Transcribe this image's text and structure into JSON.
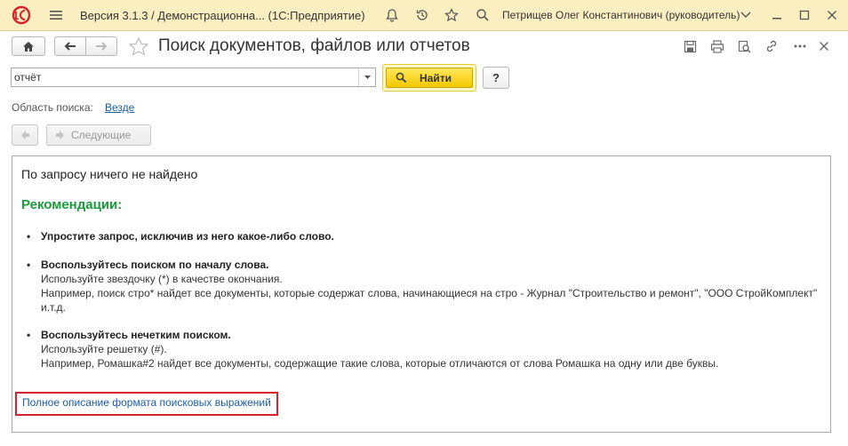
{
  "titlebar": {
    "title": "Версия 3.1.3 / Демонстрационна...  (1С:Предприятие)",
    "user": "Петрищев Олег Константинович (руководитель)"
  },
  "header": {
    "page_title": "Поиск документов, файлов или отчетов"
  },
  "search": {
    "value": "отчёт",
    "find_label": "Найти",
    "help_label": "?"
  },
  "search_area": {
    "label": "Область поиска:",
    "value": "Везде"
  },
  "paging": {
    "next_label": "Следующие"
  },
  "results": {
    "nothing_found": "По запросу ничего не найдено",
    "recommendations_title": "Рекомендации:",
    "tips": [
      {
        "head": "Упростите запрос, исключив из него какое-либо слово.",
        "lines": []
      },
      {
        "head": "Воспользуйтесь поиском по началу слова.",
        "lines": [
          "Используйте звездочку (*) в качестве окончания.",
          "Например, поиск стро* найдет все документы, которые содержат слова, начинающиеся на стро - Журнал \"Строительство и ремонт\", \"ООО СтройКомплект\" и.т.д."
        ]
      },
      {
        "head": "Воспользуйтесь нечетким поиском.",
        "lines": [
          "Используйте решетку (#).",
          "Например, Ромашка#2 найдет все документы, содержащие такие слова, которые отличаются от слова Ромашка на одну или две буквы."
        ]
      }
    ],
    "full_description_link": "Полное описание формата поисковых выражений"
  },
  "colors": {
    "titlebar_bg": "#fbeec0",
    "accent_green": "#1a9a3a",
    "link_blue": "#1a5ea8",
    "highlight_red": "#d6222b",
    "find_button_yellow": "#f4c800"
  }
}
